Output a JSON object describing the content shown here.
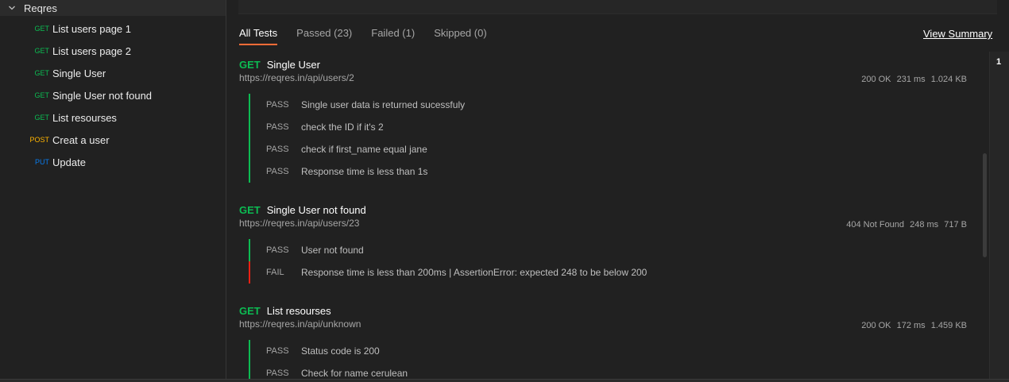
{
  "sidebar": {
    "collection_name": "Reqres",
    "requests": [
      {
        "method": "GET",
        "label": "List users page 1"
      },
      {
        "method": "GET",
        "label": "List users page 2"
      },
      {
        "method": "GET",
        "label": "Single User"
      },
      {
        "method": "GET",
        "label": "Single User not found"
      },
      {
        "method": "GET",
        "label": "List resourses"
      },
      {
        "method": "POST",
        "label": "Creat a user"
      },
      {
        "method": "PUT",
        "label": "Update"
      }
    ]
  },
  "tabs": [
    {
      "label": "All Tests",
      "active": true
    },
    {
      "label": "Passed (23)"
    },
    {
      "label": "Failed (1)"
    },
    {
      "label": "Skipped (0)"
    }
  ],
  "view_summary": "View Summary",
  "page_number": "1",
  "results": [
    {
      "method": "GET",
      "name": "Single User",
      "url": "https://reqres.in/api/users/2",
      "status": "200 OK",
      "time": "231 ms",
      "size": "1.024 KB",
      "tests": [
        {
          "status": "PASS",
          "message": "Single user data is returned sucessfuly"
        },
        {
          "status": "PASS",
          "message": "check the ID if it's 2"
        },
        {
          "status": "PASS",
          "message": "check if first_name equal jane"
        },
        {
          "status": "PASS",
          "message": "Response time is less than 1s"
        }
      ]
    },
    {
      "method": "GET",
      "name": "Single User not found",
      "url": "https://reqres.in/api/users/23",
      "status": "404 Not Found",
      "time": "248 ms",
      "size": "717 B",
      "tests": [
        {
          "status": "PASS",
          "message": "User not found"
        },
        {
          "status": "FAIL",
          "message": "Response time is less than 200ms | AssertionError: expected 248 to be below 200"
        }
      ]
    },
    {
      "method": "GET",
      "name": "List resourses",
      "url": "https://reqres.in/api/unknown",
      "status": "200 OK",
      "time": "172 ms",
      "size": "1.459 KB",
      "tests": [
        {
          "status": "PASS",
          "message": "Status code is 200"
        },
        {
          "status": "PASS",
          "message": "Check for name cerulean"
        }
      ]
    }
  ],
  "colors": {
    "get": "#0cbb52",
    "post": "#ffb400",
    "put": "#097bed",
    "pass": "#0cbb52",
    "fail": "#eb2013",
    "accent": "#ff6c37"
  },
  "icons": {
    "collection_toggle": "chevron-down-icon"
  }
}
